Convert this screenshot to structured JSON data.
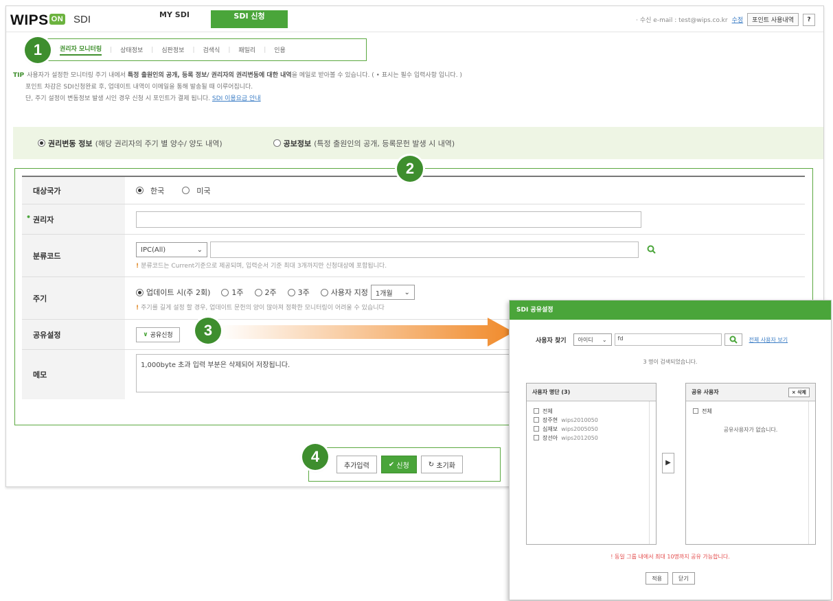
{
  "colors": {
    "brand_green": "#4aa53a",
    "badge_green": "#3e8e2e",
    "arrow_orange": "#f08a2a",
    "highlight_bg": "#eef5e4"
  },
  "header": {
    "logo": "WIPS",
    "logo_badge": "ON",
    "product": "SDI",
    "tabs": [
      {
        "label": "MY SDI"
      },
      {
        "label": "SDI 신청"
      }
    ],
    "email_label": "· 수신 e-mail : test@wips.co.kr",
    "edit_link": "수정",
    "points_button": "포인트 사용내역",
    "help_button": "?"
  },
  "subnav": {
    "items": [
      "권리자 모니터링",
      "상태정보",
      "심판정보",
      "검색식",
      "패밀리",
      "인용"
    ]
  },
  "badges": [
    "1",
    "2",
    "3",
    "4"
  ],
  "tips": {
    "label": "TIP",
    "line1_a": "사용자가 설정한 모니터링 주기 내에서",
    "line1_b": "특정 출원인의 공개, 등록 정보/ 권리자의 권리변동에 대한 내역",
    "line1_c": "을 메일로 받아볼 수 있습니다. ( • 표시는 필수 입력사항 입니다. )",
    "line2": "포인트 차감은 SDI신청완료 후, 업데이트 내역이 이메일을 통해 발송될 때 이루어집니다.",
    "line3": "단, 주기 설정이 변동정보 발생 시인 경우 신청 시 포인트가 결제 됩니다.",
    "line3_link": "SDI 이용요금 안내"
  },
  "type_select": {
    "option1_title": "권리변동 정보",
    "option1_desc": "(해당 권리자의 주기 별 양수/ 양도 내역)",
    "option2_title": "공보정보",
    "option2_desc": "(특정 출원인의 공개, 등록문헌 발생 시 내역)"
  },
  "form": {
    "country_label": "대상국가",
    "country_options": [
      "한국",
      "미국"
    ],
    "holder_label": "권리자",
    "holder_value": "",
    "code_label": "분류코드",
    "code_select": "IPC(All)",
    "code_value": "",
    "code_note": "분류코드는 Current기준으로 제공되며, 입력순서 기준 최대 3개까지만 신청대상에 포함됩니다.",
    "period_label": "주기",
    "period_options": [
      "업데이트 시(주 2회)",
      "1주",
      "2주",
      "3주",
      "사용자 지정"
    ],
    "period_custom_select": "1개월",
    "period_note": "주기를 길게 설정 할 경우, 업데이트 문헌의 양이 많아져 정확한 모니터링이 어려울 수 있습니다",
    "share_label": "공유설정",
    "share_button": "공유신청",
    "memo_label": "메모",
    "memo_value": "1,000byte 초과 입력 부분은 삭제되어 저장됩니다."
  },
  "actions": {
    "add": "추가입력",
    "submit": "신청",
    "reset": "초기화"
  },
  "popup": {
    "title": "SDI 공유설정",
    "search_label": "사용자 찾기",
    "search_select": "아이디",
    "search_value": "fd",
    "all_users_link": "전체 사용자 보기",
    "result_text": "3 명이 검색되었습니다.",
    "left_title": "사용자 명단 (3)",
    "all_label": "전체",
    "users": [
      {
        "name": "장주현",
        "id": "wips2010050"
      },
      {
        "name": "심재보",
        "id": "wips2005050"
      },
      {
        "name": "장선아",
        "id": "wips2012050"
      }
    ],
    "right_title": "공유 사용자",
    "delete_button": "× 삭제",
    "right_all_label": "전체",
    "empty_text": "공유사용자가 없습니다.",
    "warning": "동일 그룹 내에서 최대 10명까지 공유 가능합니다.",
    "apply_button": "적용",
    "close_button": "닫기"
  }
}
